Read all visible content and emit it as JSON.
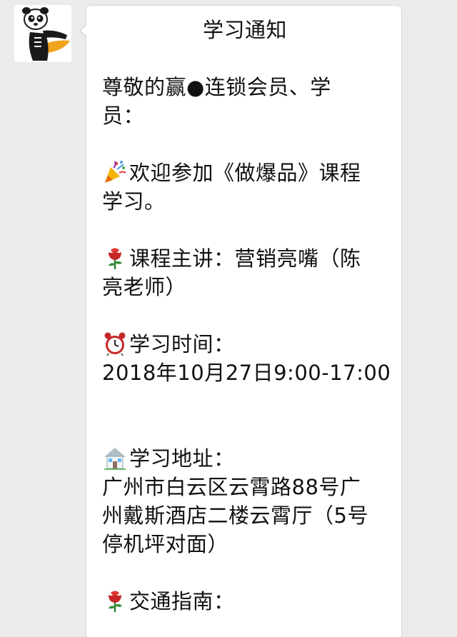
{
  "message": {
    "title": "学习通知",
    "greeting_1": "尊敬的赢●连锁会员、学",
    "greeting_2": "员：",
    "welcome_1": "欢迎参加《做爆品》课程",
    "welcome_2": "学习。",
    "speaker_1": "课程主讲：营销亮嘴（陈",
    "speaker_2": "亮老师）",
    "time_label": "学习时间：",
    "time_value": "2018年10月27日9:00-17:00",
    "address_label": "学习地址：",
    "address_1": "广州市白云区云霄路88号广",
    "address_2": "州戴斯酒店二楼云霄厅（5号",
    "address_3": "停机坪对面）",
    "traffic_label": "交通指南："
  },
  "icons": {
    "avatar": "panda-avatar",
    "party": "party-popper-icon",
    "rose": "rose-icon",
    "clock": "alarm-clock-icon",
    "house": "house-icon"
  }
}
